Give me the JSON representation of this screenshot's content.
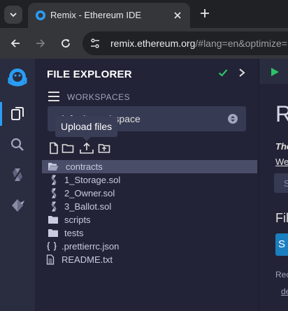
{
  "browser": {
    "tab_title": "Remix - Ethereum IDE",
    "url_host": "remix.ethereum.org",
    "url_rest": "/#lang=en&optimize="
  },
  "panel": {
    "title": "FILE EXPLORER",
    "workspaces_label": "WORKSPACES",
    "workspace_selected": "default_workspace",
    "tooltip": "Upload files"
  },
  "tree": {
    "items": [
      {
        "label": "contracts",
        "type": "folder-open",
        "selected": true
      },
      {
        "label": "1_Storage.sol",
        "type": "solidity"
      },
      {
        "label": "2_Owner.sol",
        "type": "solidity"
      },
      {
        "label": "3_Ballot.sol",
        "type": "solidity"
      },
      {
        "label": "scripts",
        "type": "folder"
      },
      {
        "label": "tests",
        "type": "folder"
      },
      {
        "label": ".prettierrc.json",
        "type": "json"
      },
      {
        "label": "README.txt",
        "type": "text"
      }
    ]
  },
  "home": {
    "heading_fragment": "R",
    "the_fragment": "The",
    "we_fragment": "We",
    "search_fragment": "S",
    "files_fragment": "Fil",
    "button_fragment": "S",
    "rec_fragment": "Rec",
    "de_fragment": "de"
  },
  "colors": {
    "accent": "#2a9df4",
    "check": "#2dc26b",
    "run": "#2dc26b",
    "panel_bg": "#222336",
    "iconbar_bg": "#2a2c3f"
  },
  "icons": [
    "chevron-down-icon",
    "remix-favicon-icon",
    "close-icon",
    "plus-icon",
    "back-icon",
    "forward-icon",
    "reload-icon",
    "site-info-icon",
    "remix-logo-icon",
    "file-explorer-icon",
    "search-icon",
    "solidity-compiler-icon",
    "deploy-icon",
    "check-icon",
    "chevron-right-icon",
    "hamburger-icon",
    "new-file-icon",
    "new-folder-icon",
    "upload-files-icon",
    "upload-folder-icon",
    "play-icon"
  ]
}
